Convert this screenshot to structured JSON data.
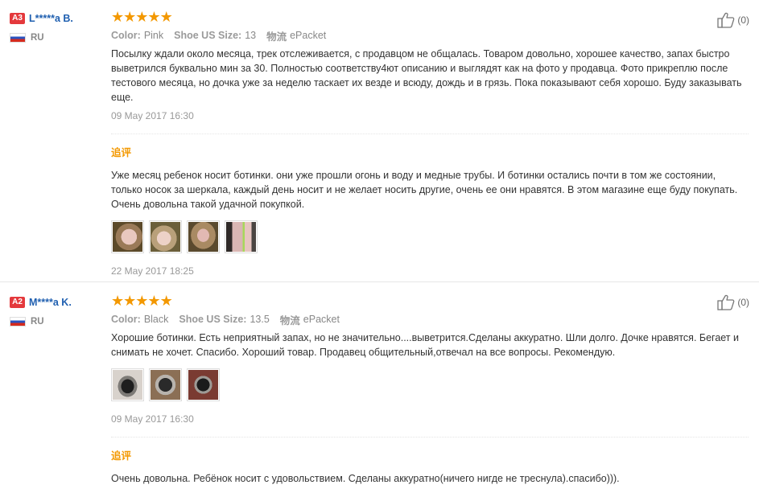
{
  "reviews": [
    {
      "level": "A3",
      "user": "L*****a B.",
      "country": "RU",
      "rating": 5,
      "attributes": [
        {
          "key": "Color:",
          "value": "Pink"
        },
        {
          "key": "Shoe US Size:",
          "value": "13"
        },
        {
          "key": "物流",
          "value": "ePacket"
        }
      ],
      "text": "Посылку ждали около месяца, трек отслеживается, с продавцом не общалась. Товаром довольно, хорошее качество, запах быстро выветрился буквально мин за 30. Полностью соответству4ют описанию и выглядят как на фото у продавца. Фото прикреплю после тестового месяца, но дочка уже за неделю таскает их везде и всюду, дождь и в грязь. Пока показывают себя хорошо. Буду заказывать еще.",
      "date": "09 May 2017 16:30",
      "followup_label": "追评",
      "followup_text": "Уже месяц ребенок носит ботинки. они уже прошли огонь и воду и медные трубы. И ботинки остались почти в том же состоянии, только носок за шеркала, каждый день носит и не желает носить другие, очень ее они нравятся. В этом магазине еще буду покупать. Очень довольна такой удачной покупкой.",
      "followup_photos": [
        "photo-1",
        "photo-2",
        "photo-3",
        "photo-4"
      ],
      "followup_date": "22 May 2017 18:25",
      "likes": "(0)"
    },
    {
      "level": "A2",
      "user": "M****a K.",
      "country": "RU",
      "rating": 5,
      "attributes": [
        {
          "key": "Color:",
          "value": "Black"
        },
        {
          "key": "Shoe US Size:",
          "value": "13.5"
        },
        {
          "key": "物流",
          "value": "ePacket"
        }
      ],
      "text": "Хорошие ботинки. Есть неприятный запах, но не значительно....выветрится.Сделаны аккуратно. Шли долго. Дочке нравятся. Бегает и снимать не хочет. Спасибо. Хороший товар. Продавец общительный,отвечал на все вопросы. Рекомендую.",
      "photos": [
        "photo-1",
        "photo-2",
        "photo-3"
      ],
      "date": "09 May 2017 16:30",
      "followup_label": "追评",
      "followup_text": "Очень довольна. Ребёнок носит с удовольствием. Сделаны аккуратно(ничего нигде не треснула).спасибо))).",
      "likes": "(0)"
    }
  ],
  "colors": {
    "level_badge": "#e4393c",
    "username": "#1f5fb0",
    "stars": "#f39800",
    "followup_label": "#f39800"
  },
  "icons": {
    "like": "thumbs-up-icon",
    "flag": "russia-flag-icon",
    "star": "star-icon"
  }
}
